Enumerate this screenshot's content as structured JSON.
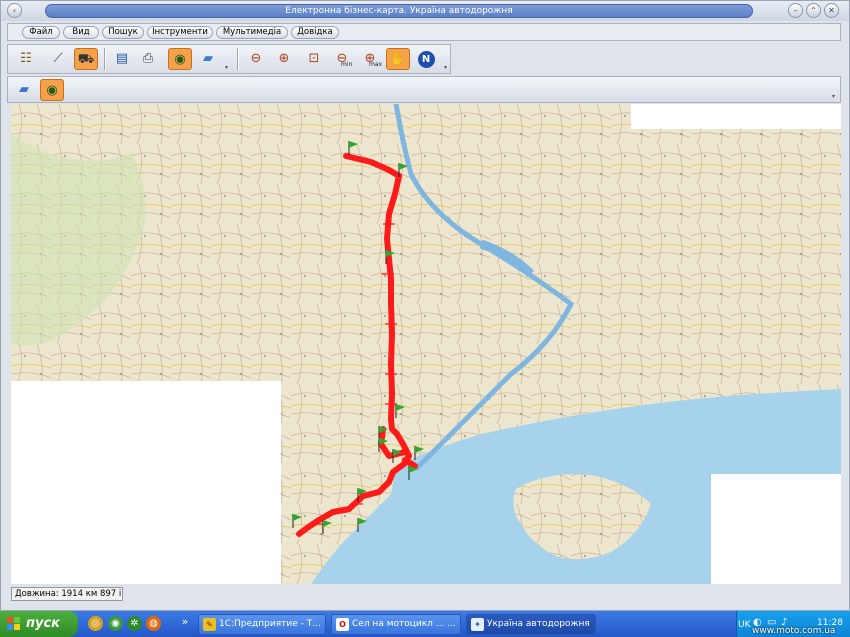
{
  "window": {
    "title": "Електронна бізнес-карта. Україна автодорожня"
  },
  "menu": {
    "items": [
      "Файл",
      "Вид",
      "Пошук",
      "Інструменти",
      "Мультимедіа",
      "Довідка"
    ]
  },
  "toolbar": {
    "tools": [
      {
        "name": "layers-tool-icon",
        "glyph": "☷"
      },
      {
        "name": "measure-tool-icon",
        "glyph": "⟋"
      },
      {
        "name": "route-tool-icon",
        "glyph": "⛟"
      },
      {
        "name": "table-tool-icon",
        "glyph": "▤"
      },
      {
        "name": "print-tool-icon",
        "glyph": "⎙"
      },
      {
        "name": "view-tool-icon",
        "glyph": "◉"
      },
      {
        "name": "eraser-tool-icon",
        "glyph": "▰"
      }
    ],
    "zoom_tools": [
      {
        "name": "zoom-out-icon",
        "glyph": "⊖"
      },
      {
        "name": "zoom-in-icon",
        "glyph": "⊕"
      },
      {
        "name": "zoom-rect-icon",
        "glyph": "⊡"
      },
      {
        "name": "zoom-min-icon",
        "glyph": "⊖",
        "label": "min"
      },
      {
        "name": "zoom-max-icon",
        "glyph": "⊕",
        "label": "max"
      },
      {
        "name": "pan-hand-icon",
        "glyph": "✋"
      },
      {
        "name": "north-compass-icon",
        "glyph": "N"
      }
    ]
  },
  "status": {
    "length_text": "Довжина: 1914 км 897 і"
  },
  "taskbar": {
    "start_label": "пуск",
    "tasks": [
      {
        "label": "1С:Предприятие - Т...",
        "icon_color": "#e8c020"
      },
      {
        "label": "Сел на мотоцикл ... ...",
        "icon_color": "#d01010"
      },
      {
        "label": "Україна автодорожня",
        "icon_color": "#2050c0"
      }
    ],
    "tray_lang": "UK",
    "clock": "11:28"
  },
  "watermark": "www.moto.com.ua",
  "colors": {
    "route": "#ff1a1a",
    "flag": "#2ea82e",
    "land": "#ece6cf",
    "sea": "#a7d2ec"
  }
}
